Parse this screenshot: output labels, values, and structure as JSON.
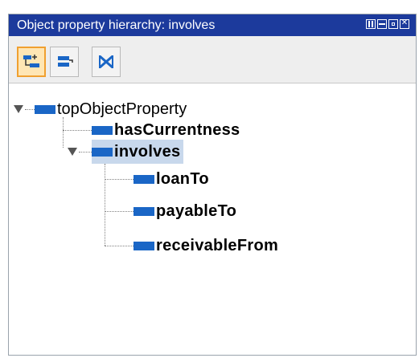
{
  "panel": {
    "title": "Object property hierarchy: involves",
    "window_buttons": [
      "restore-icon",
      "maximize-icon",
      "minimize-icon",
      "close-icon"
    ]
  },
  "toolbar": {
    "buttons": [
      {
        "name": "add-subproperty",
        "icon": "add-subproperty-icon",
        "active": true
      },
      {
        "name": "add-sibling-property",
        "icon": "add-sibling-icon",
        "active": false
      },
      {
        "name": "delete-property",
        "icon": "delete-icon",
        "active": false
      }
    ]
  },
  "tree": {
    "root": {
      "label": "topObjectProperty",
      "expanded": true
    },
    "has_currentness": {
      "label": "hasCurrentness"
    },
    "involves": {
      "label": "involves",
      "expanded": true,
      "selected": true
    },
    "loan_to": {
      "label": "loanTo"
    },
    "payable_to": {
      "label": "payableTo"
    },
    "receivable_from": {
      "label": "receivableFrom"
    }
  },
  "colors": {
    "title_bar": "#1c3a9c",
    "property_bar": "#1a66c6",
    "selection": "#c8d8ec",
    "active_button": "#ffe6b4"
  }
}
